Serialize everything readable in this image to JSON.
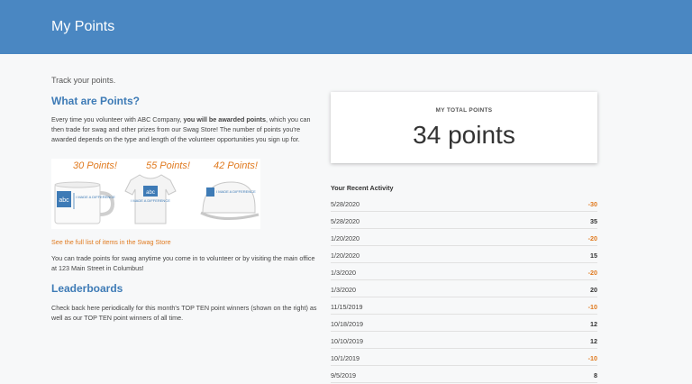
{
  "header": {
    "title": "My Points"
  },
  "intro": {
    "tagline": "Track your points."
  },
  "points_section": {
    "heading": "What are Points?",
    "para_pre": "Every time you volunteer with ABC Company, ",
    "para_bold": "you will be awarded points",
    "para_post": ", which you can then trade for swag and other prizes from our Swag Store! The number of points you're awarded depends on the type and length of the volunteer opportunities you sign up for.",
    "swag_labels": [
      "30 Points!",
      "55 Points!",
      "42 Points!"
    ],
    "swag_brand": "abc",
    "swag_slogan": "I MADE A DIFFERENCE",
    "swag_link": "See the full list of items in the Swag Store",
    "trade_text": "You can trade points for swag anytime you come in to volunteer or by visiting the main office at 123 Main Street in Columbus!"
  },
  "leaderboards": {
    "heading": "Leaderboards",
    "text": "Check back here periodically for this month's TOP TEN point winners (shown on the right) as well as our TOP TEN point winners of all time."
  },
  "total": {
    "label": "MY TOTAL POINTS",
    "value": "34 points"
  },
  "activity": {
    "title": "Your Recent Activity",
    "rows": [
      {
        "date": "5/28/2020",
        "points": "-30"
      },
      {
        "date": "5/28/2020",
        "points": "35"
      },
      {
        "date": "1/20/2020",
        "points": "-20"
      },
      {
        "date": "1/20/2020",
        "points": "15"
      },
      {
        "date": "1/3/2020",
        "points": "-20"
      },
      {
        "date": "1/3/2020",
        "points": "20"
      },
      {
        "date": "11/15/2019",
        "points": "-10"
      },
      {
        "date": "10/18/2019",
        "points": "12"
      },
      {
        "date": "10/10/2019",
        "points": "12"
      },
      {
        "date": "10/1/2019",
        "points": "-10"
      },
      {
        "date": "9/5/2019",
        "points": "8"
      }
    ]
  },
  "colors": {
    "header": "#4a87c2",
    "accent": "#e07a1f",
    "heading": "#3e7bb6"
  }
}
